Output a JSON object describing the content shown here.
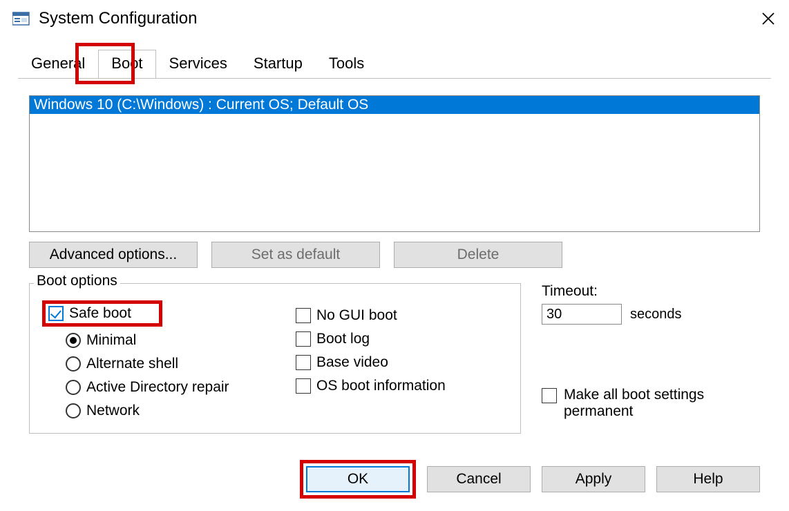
{
  "window": {
    "title": "System Configuration"
  },
  "tabs": {
    "general": "General",
    "boot": "Boot",
    "services": "Services",
    "startup": "Startup",
    "tools": "Tools",
    "active": "boot"
  },
  "os_list": {
    "items": [
      "Windows 10 (C:\\Windows) : Current OS; Default OS"
    ]
  },
  "buttons_row": {
    "advanced": "Advanced options...",
    "set_default": "Set as default",
    "delete": "Delete"
  },
  "boot_options": {
    "legend": "Boot options",
    "safe_boot": {
      "label": "Safe boot",
      "checked": true
    },
    "minimal": {
      "label": "Minimal",
      "selected": true
    },
    "alternate_shell": {
      "label": "Alternate shell",
      "selected": false
    },
    "ad_repair": {
      "label": "Active Directory repair",
      "selected": false
    },
    "network": {
      "label": "Network",
      "selected": false
    },
    "no_gui": {
      "label": "No GUI boot",
      "checked": false
    },
    "boot_log": {
      "label": "Boot log",
      "checked": false
    },
    "base_video": {
      "label": "Base video",
      "checked": false
    },
    "os_boot_info": {
      "label": "OS boot information",
      "checked": false
    }
  },
  "timeout": {
    "label": "Timeout:",
    "value": "30",
    "unit": "seconds"
  },
  "permanent": {
    "label": "Make all boot settings permanent",
    "checked": false
  },
  "dialog_buttons": {
    "ok": "OK",
    "cancel": "Cancel",
    "apply": "Apply",
    "help": "Help"
  },
  "highlights": {
    "boot_tab": true,
    "safe_boot": true,
    "ok": true
  }
}
